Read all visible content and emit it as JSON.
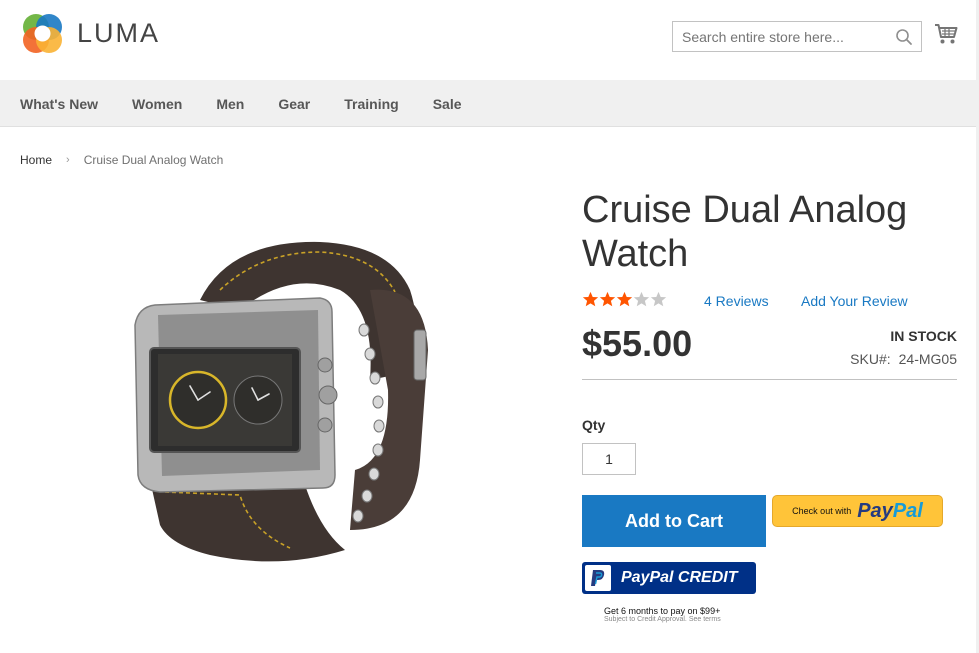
{
  "brand": {
    "name": "LUMA",
    "colors": {
      "orange": "#f26322",
      "green": "#6cb33e",
      "blue": "#1979c3",
      "teal": "#00a6a0"
    }
  },
  "header": {
    "search": {
      "placeholder": "Search entire store here...",
      "value": ""
    },
    "icons": {
      "search": "search-icon",
      "cart": "cart-icon"
    }
  },
  "nav": {
    "items": [
      {
        "label": "What's New"
      },
      {
        "label": "Women"
      },
      {
        "label": "Men"
      },
      {
        "label": "Gear"
      },
      {
        "label": "Training"
      },
      {
        "label": "Sale"
      }
    ]
  },
  "breadcrumb": {
    "home": "Home",
    "separator": "›",
    "current": "Cruise Dual Analog Watch"
  },
  "product": {
    "title": "Cruise Dual Analog Watch",
    "rating": {
      "value": 3,
      "max": 5,
      "filled_color": "#ff5501",
      "empty_color": "#c7c7c7"
    },
    "reviews_link": "4 Reviews",
    "add_review_link": "Add Your Review",
    "price": "$55.00",
    "stock": "IN STOCK",
    "sku_label": "SKU#:",
    "sku_value": "24-MG05",
    "qty_label": "Qty",
    "qty_value": "1",
    "image_icon": "watch-product-image"
  },
  "actions": {
    "add_to_cart": "Add to Cart",
    "paypal_checkout_prefix": "Check out with",
    "paypal_logo_dark": "Pay",
    "paypal_logo_light": "Pal",
    "paypal_credit": "PayPal CREDIT",
    "credit_note": "Get 6 months to pay on $99+",
    "credit_sub": "Subject to Credit Approval. See terms"
  }
}
